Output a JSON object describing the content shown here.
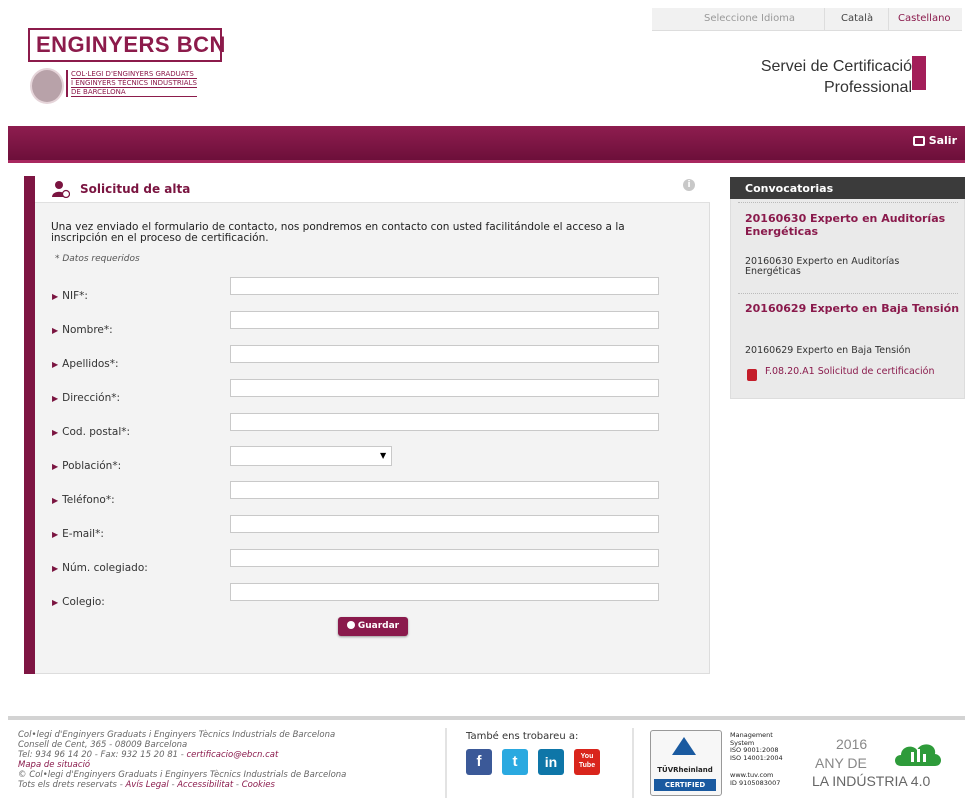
{
  "lang": {
    "prompt": "Seleccione Idioma",
    "options": [
      "Català",
      "Castellano"
    ]
  },
  "header": {
    "logo": "ENGINYERS BCN",
    "college_lines": [
      "COL·LEGI D'ENGINYERS GRADUATS",
      "I ENGINYERS TÈCNICS INDUSTRIALS",
      "DE BARCELONA"
    ],
    "service_line1": "Servei de Certificació",
    "service_line2": "Professional"
  },
  "nav": {
    "logout": "Salir"
  },
  "form": {
    "title": "Solicitud de alta",
    "intro": "Una vez enviado el formulario de contacto, nos pondremos en contacto con usted facilitándole el acceso a la inscripción en el proceso de certificación.",
    "required_note": "* Datos requeridos",
    "labels": {
      "nif": "NIF*:",
      "nombre": "Nombre*:",
      "apellidos": "Apellidos*:",
      "direccion": "Dirección*:",
      "cp": "Cod. postal*:",
      "poblacion": "Población*:",
      "telefono": "Teléfono*:",
      "email": "E-mail*:",
      "colegiado": "Núm. colegiado:",
      "colegio": "Colegio:"
    },
    "submit": "Guardar"
  },
  "sidebar": {
    "title": "Convocatorias",
    "items": [
      {
        "title": "20160630 Experto en Auditorías Energéticas",
        "desc": "20160630 Experto en Auditorías Energéticas"
      },
      {
        "title": "20160629 Experto en Baja Tensión",
        "desc": "20160629 Experto en Baja Tensión",
        "doc": "F.08.20.A1 Solicitud de certificación"
      }
    ]
  },
  "footer": {
    "org": "Col•legi d'Enginyers Graduats i Enginyers Tècnics Industrials de Barcelona",
    "address": "Consell de Cent, 365 - 08009 Barcelona",
    "contact": "Tel: 934 96 14 20 - Fax: 932 15 20 81 - ",
    "email": "certificacio@ebcn.cat",
    "map": "Mapa de situació",
    "copyright": "© Col•legi d'Enginyers Graduats i Enginyers Tècnics Industrials de Barcelona",
    "rights": "Tots els drets reservats - ",
    "legal": "Avís Legal",
    "access": "Accessibilitat",
    "cookies": "Cookies",
    "social_title": "També ens trobareu a:",
    "social": [
      "f",
      "t",
      "in",
      "You Tube"
    ],
    "tuv_name": "TÜVRheinland",
    "tuv_cert": "CERTIFIED",
    "mgmt_lines": [
      "Management",
      "System",
      "ISO 9001:2008",
      "ISO 14001:2004"
    ],
    "tuv_web": [
      "www.tuv.com",
      "ID 9105083007"
    ],
    "year": "2016",
    "any_de": "ANY DE",
    "industria": "LA INDÚSTRIA 4.0"
  },
  "colors": {
    "brand": "#8a1a4c",
    "band": "#7a1440"
  },
  "icons": [
    "logout-icon",
    "user-add-icon",
    "info-icon",
    "pdf-icon",
    "select-arrow-icon",
    "check-icon",
    "facebook-icon",
    "twitter-icon",
    "linkedin-icon",
    "youtube-icon",
    "tuv-logo",
    "cloud-icon"
  ]
}
